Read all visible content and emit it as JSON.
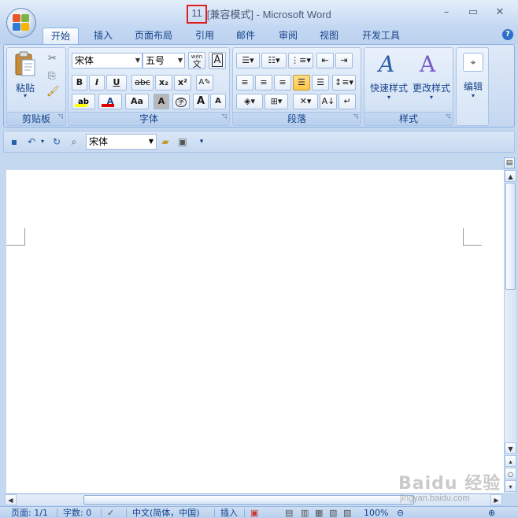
{
  "title": {
    "doc_name": "11",
    "mode": "[兼容模式]",
    "separator": " - ",
    "app": "Microsoft Word"
  },
  "window_buttons": {
    "minimize": "–",
    "restore": "▭",
    "close": "✕"
  },
  "tabs": [
    {
      "label": "开始",
      "active": true
    },
    {
      "label": "插入"
    },
    {
      "label": "页面布局"
    },
    {
      "label": "引用"
    },
    {
      "label": "邮件"
    },
    {
      "label": "审阅"
    },
    {
      "label": "视图"
    },
    {
      "label": "开发工具"
    }
  ],
  "help_icon": "?",
  "ribbon": {
    "clipboard": {
      "label": "剪贴板",
      "paste": "粘贴"
    },
    "font": {
      "label": "字体",
      "font_name": "宋体",
      "font_size": "五号",
      "bold": "B",
      "italic": "I",
      "underline": "U",
      "strike": "abc",
      "subscript": "x₂",
      "superscript": "x²",
      "wen": "文",
      "wen_top": "wén",
      "font_color": "A",
      "case": "Aa",
      "char_shading": "A",
      "enclose": "字",
      "grow": "A",
      "shrink": "A"
    },
    "paragraph": {
      "label": "段落"
    },
    "styles": {
      "label": "样式",
      "quick_styles": "快速样式",
      "change_styles": "更改样式"
    },
    "editing": {
      "label": "编辑"
    }
  },
  "qat": {
    "font_value": "宋体"
  },
  "status": {
    "page": "页面: 1/1",
    "words": "字数: 0",
    "language": "中文(简体，中国)",
    "insert": "插入",
    "zoom": "100%"
  },
  "watermark": {
    "brand": "Baidu 经验",
    "url": "jingyan.baidu.com"
  },
  "colors": {
    "title_highlight": "#e02020",
    "ribbon_text": "#15428b",
    "font_color_bar": "#e00000",
    "highlight_bar": "#ffff00"
  }
}
